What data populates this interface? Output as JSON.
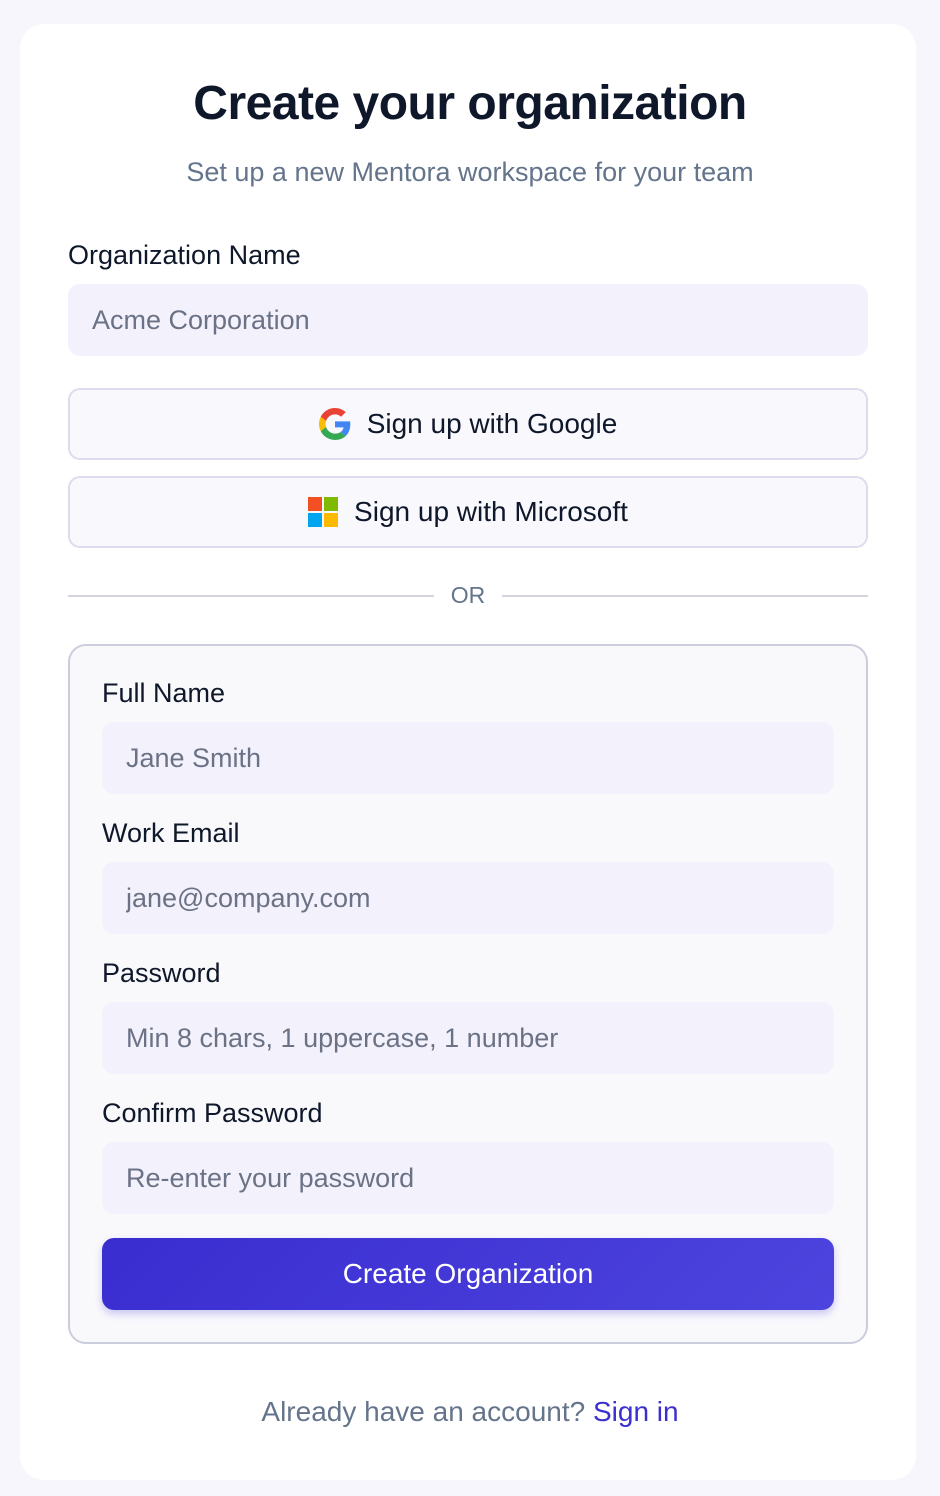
{
  "header": {
    "title": "Create your organization",
    "subtitle": "Set up a new Mentora workspace for your team"
  },
  "organization": {
    "label": "Organization Name",
    "placeholder": "Acme Corporation"
  },
  "oauth": {
    "google_label": "Sign up with Google",
    "microsoft_label": "Sign up with Microsoft"
  },
  "divider": {
    "text": "OR"
  },
  "form": {
    "full_name": {
      "label": "Full Name",
      "placeholder": "Jane Smith"
    },
    "email": {
      "label": "Work Email",
      "placeholder": "jane@company.com"
    },
    "password": {
      "label": "Password",
      "placeholder": "Min 8 chars, 1 uppercase, 1 number"
    },
    "confirm_password": {
      "label": "Confirm Password",
      "placeholder": "Re-enter your password"
    },
    "submit_label": "Create Organization"
  },
  "footer": {
    "prompt": "Already have an account?",
    "link_label": "Sign in"
  },
  "colors": {
    "accent": "#3b2fd0",
    "background": "#f6f6fc",
    "input_bg": "#f3f2fc"
  },
  "icons": {
    "google": "google-logo-icon",
    "microsoft": "microsoft-logo-icon"
  }
}
